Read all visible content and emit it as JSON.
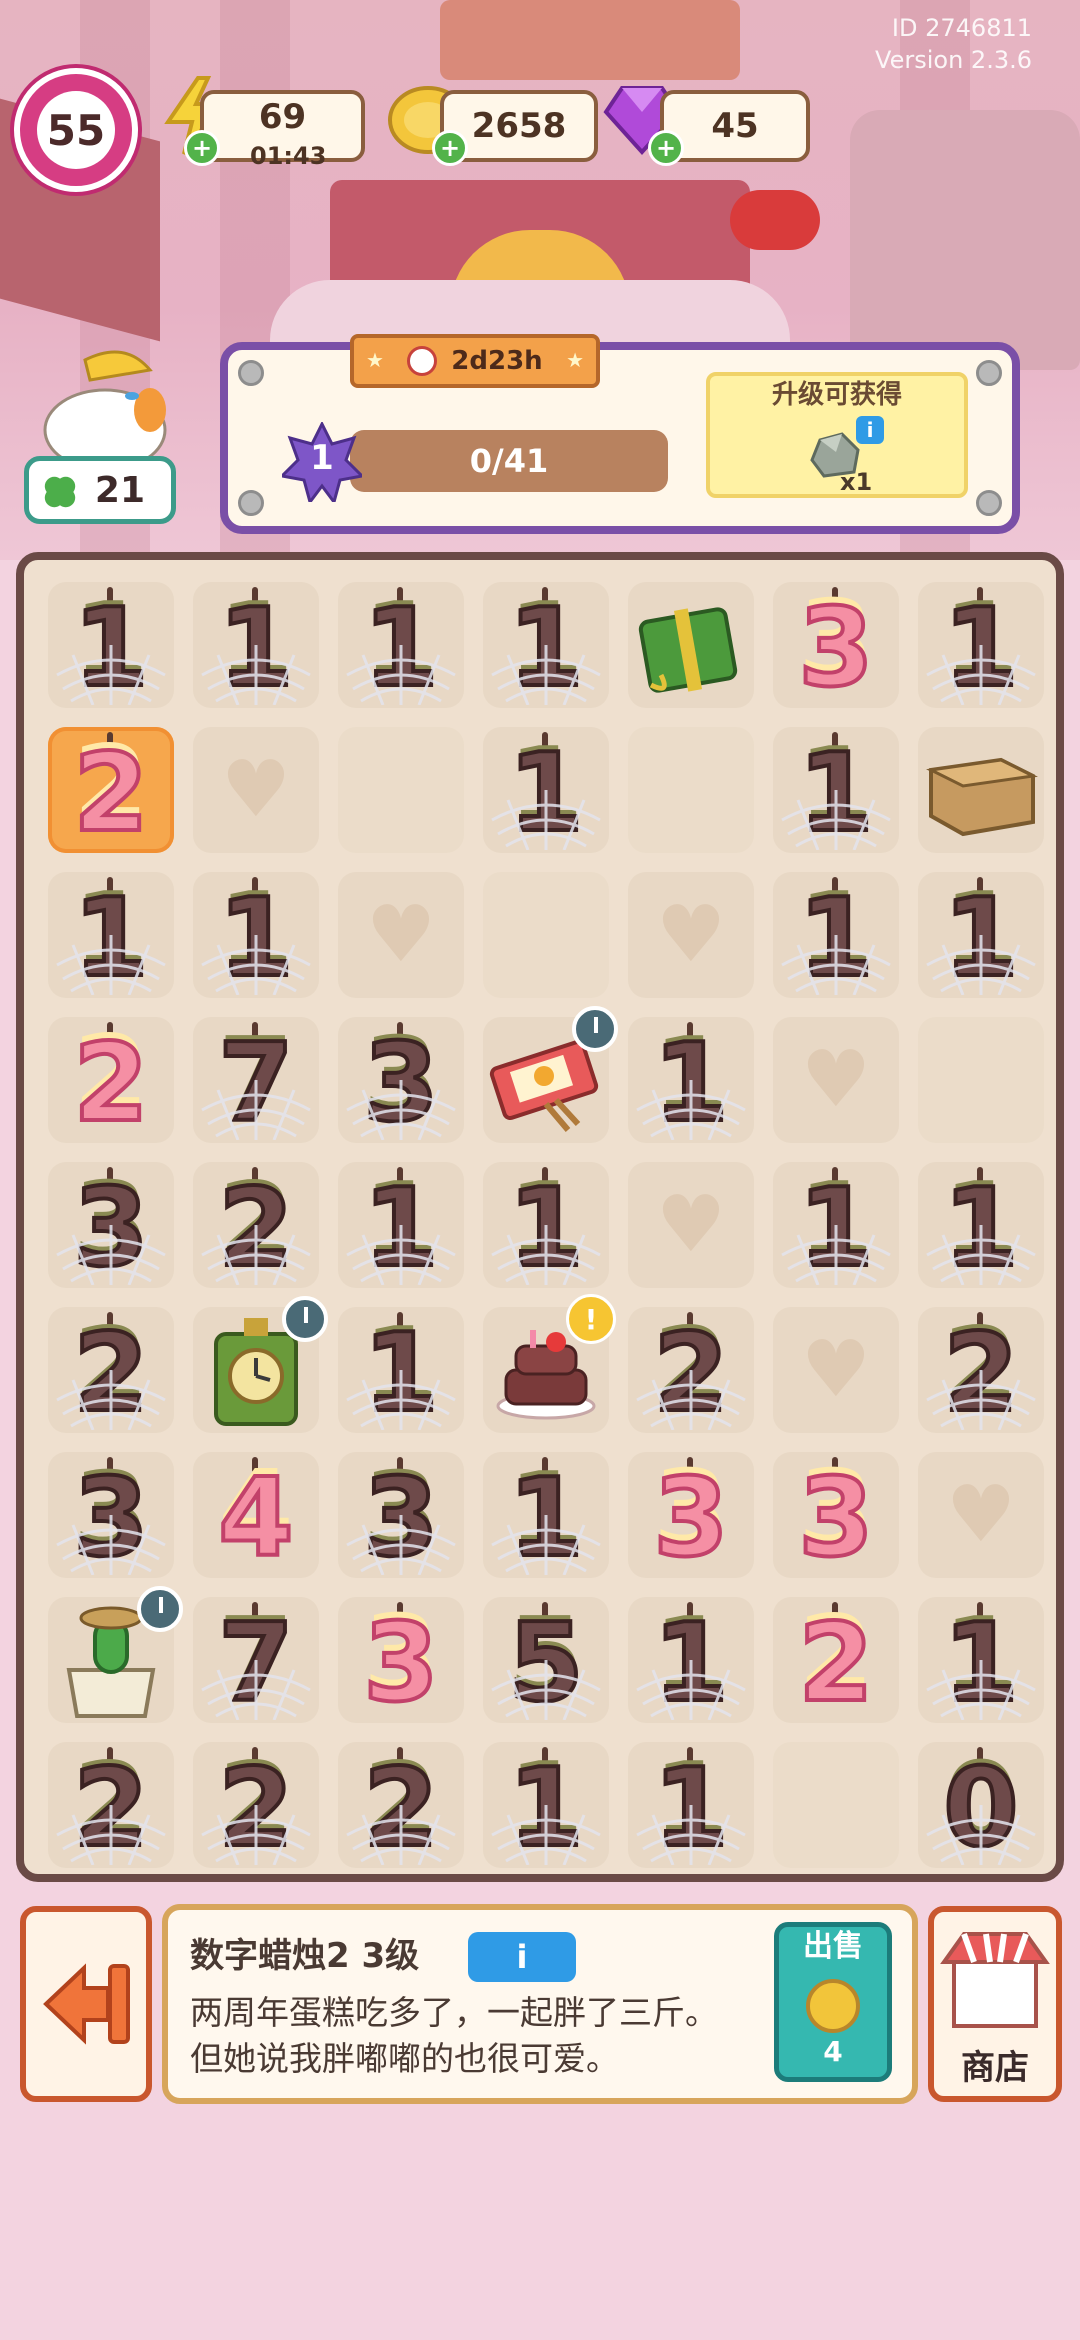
{
  "meta": {
    "id_text": "ID 2746811",
    "version_text": "Version 2.3.6"
  },
  "hud": {
    "level": "55",
    "energy": {
      "value": "69",
      "timer": "01:43",
      "icon": "lightning-icon"
    },
    "coins": {
      "value": "2658",
      "icon": "coin-icon"
    },
    "gems": {
      "value": "45",
      "icon": "gem-icon"
    },
    "clover_count": "21"
  },
  "progress_panel": {
    "timer": "2d23h",
    "step": "1",
    "progress_text": "0/41",
    "progress_fraction": 0,
    "reward_title": "升级可获得",
    "reward_qty": "x1",
    "reward_icon": "rock-icon"
  },
  "board": {
    "rows": 9,
    "cols": 7,
    "cells": [
      [
        "candle-web:1",
        "candle-web:1",
        "candle-web:1",
        "candle-web:1",
        "gift-box",
        "candle-pink:3",
        "candle-web:1"
      ],
      [
        "candle-pink-selected:2",
        "heart",
        "empty",
        "candle-web:1",
        "empty",
        "candle-web:1",
        "cardboard-box"
      ],
      [
        "candle-web:1",
        "candle-web:1",
        "heart",
        "empty",
        "heart",
        "candle-web:1",
        "candle-web:1"
      ],
      [
        "candle-pink:2",
        "candle-web:7",
        "candle-web:3",
        "matchbox",
        "candle-web:1",
        "heart",
        "empty"
      ],
      [
        "candle-web:3",
        "candle-web:2",
        "candle-web:1",
        "candle-web:1",
        "heart",
        "candle-web:1",
        "candle-web:1"
      ],
      [
        "candle-web:2",
        "green-clock",
        "candle-web:1",
        "birthday-cake",
        "candle-web:2",
        "heart",
        "candle-web:2"
      ],
      [
        "candle-web:3",
        "candle-pink:4",
        "candle-web:3",
        "candle-web:1",
        "candle-pink:3",
        "candle-pink:3",
        "heart"
      ],
      [
        "cactus-pot",
        "candle-web:7",
        "candle-pink:3",
        "candle-web:5",
        "candle-web:1",
        "candle-pink:2",
        "candle-web:1"
      ],
      [
        "candle-web:2",
        "candle-web:2",
        "candle-web:2",
        "candle-web:1",
        "candle-web:1",
        "empty",
        "candle-web:0"
      ]
    ]
  },
  "info_bar": {
    "item_name": "数字蜡烛2 3级",
    "info_icon": "i",
    "description": "两周年蛋糕吃多了，一起胖了三斤。但她说我胖嘟嘟的也很可爱。",
    "sell_label": "出售",
    "sell_price": "4",
    "shop_label": "商店"
  }
}
